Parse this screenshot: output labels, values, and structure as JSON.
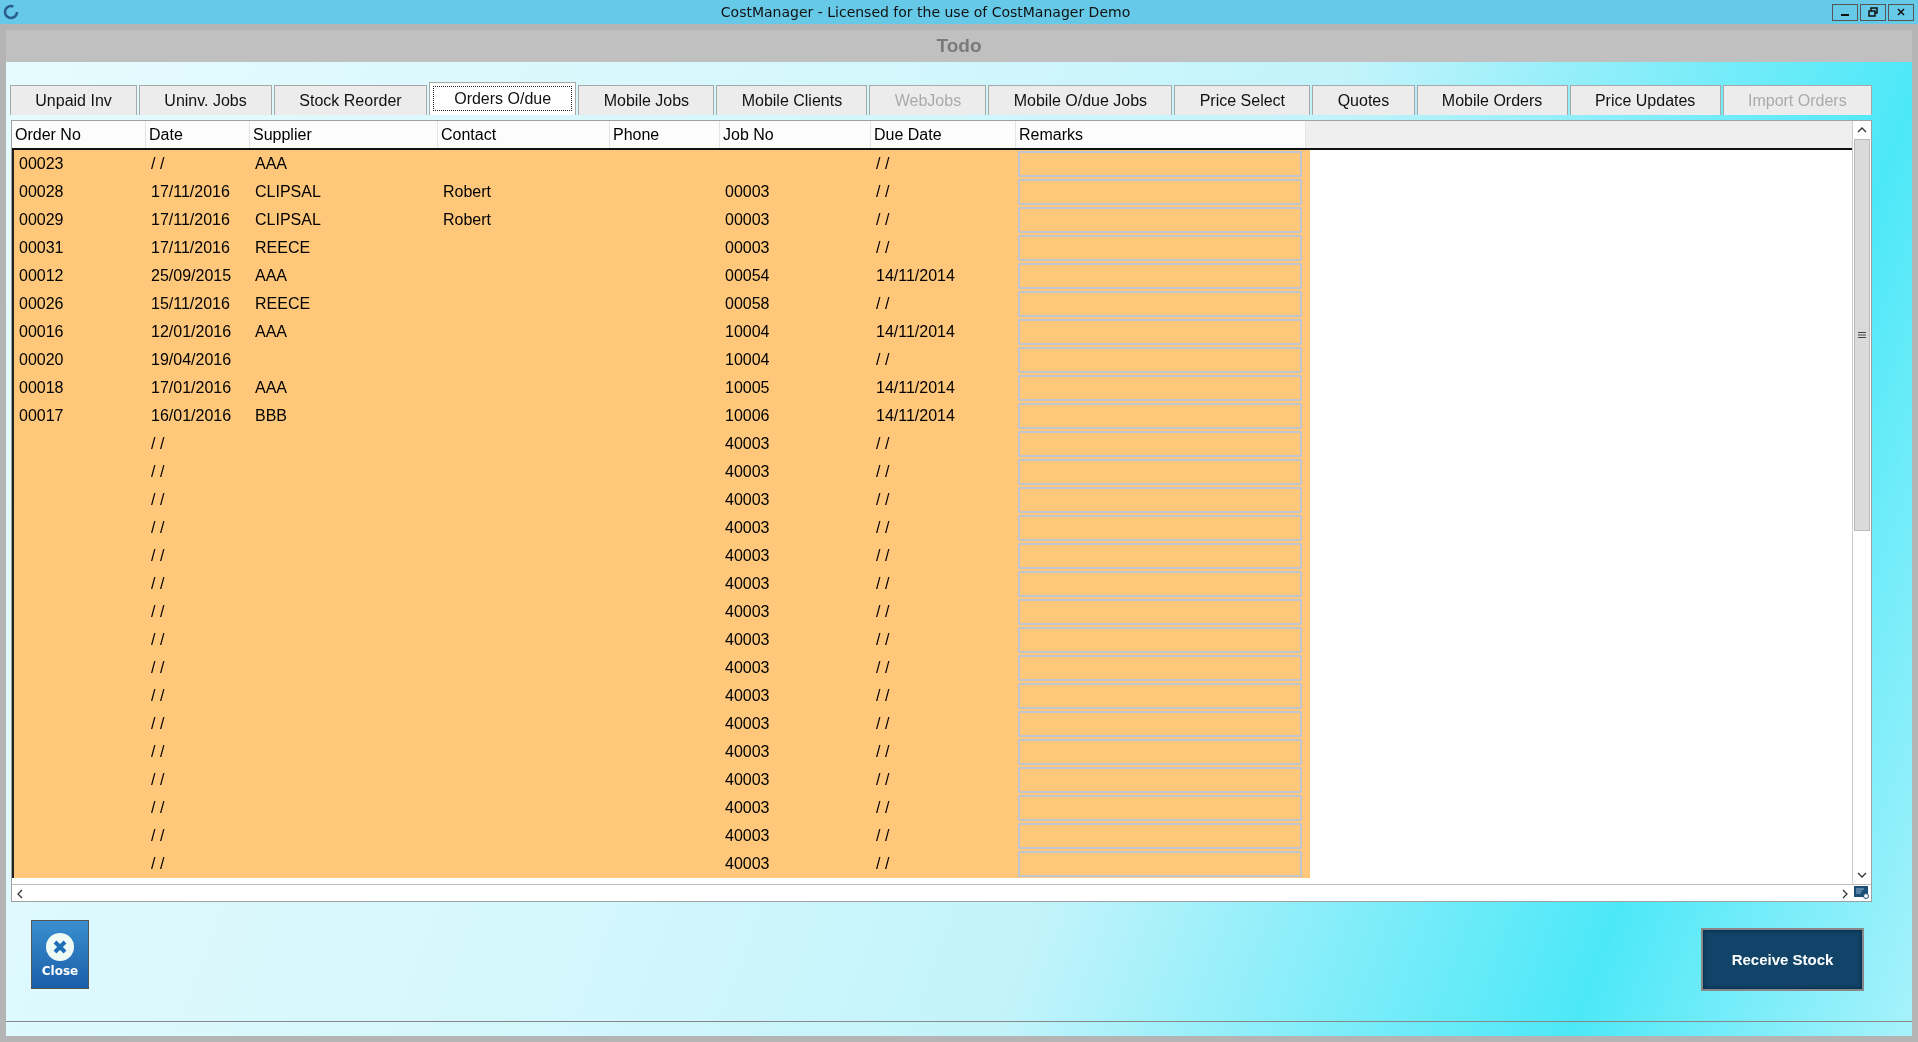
{
  "window": {
    "title": "CostManager - Licensed for the use of CostManager Demo"
  },
  "form_title": "Todo",
  "tabs": [
    {
      "label": "Unpaid Inv",
      "selected": false,
      "disabled": false
    },
    {
      "label": "Uninv. Jobs",
      "selected": false,
      "disabled": false
    },
    {
      "label": "Stock Reorder",
      "selected": false,
      "disabled": false
    },
    {
      "label": "Orders O/due",
      "selected": true,
      "disabled": false
    },
    {
      "label": "Mobile Jobs",
      "selected": false,
      "disabled": false
    },
    {
      "label": "Mobile Clients",
      "selected": false,
      "disabled": false
    },
    {
      "label": "WebJobs",
      "selected": false,
      "disabled": true
    },
    {
      "label": "Mobile O/due Jobs",
      "selected": false,
      "disabled": false
    },
    {
      "label": "Price Select",
      "selected": false,
      "disabled": false
    },
    {
      "label": "Quotes",
      "selected": false,
      "disabled": false
    },
    {
      "label": "Mobile Orders",
      "selected": false,
      "disabled": false
    },
    {
      "label": "Price Updates",
      "selected": false,
      "disabled": false
    },
    {
      "label": "Import Orders",
      "selected": false,
      "disabled": true
    }
  ],
  "table": {
    "columns": [
      "Order No",
      "Date",
      "Supplier",
      "Contact",
      "Phone",
      "Job No",
      "Due Date",
      "Remarks"
    ],
    "rows": [
      {
        "order_no": "00023",
        "date": "/ /",
        "supplier": "AAA",
        "due_date": "/ /"
      },
      {
        "order_no": "00028",
        "date": "17/11/2016",
        "supplier": "CLIPSAL",
        "contact": "Robert",
        "job_no": "00003",
        "due_date": "/ /"
      },
      {
        "order_no": "00029",
        "date": "17/11/2016",
        "supplier": "CLIPSAL",
        "contact": "Robert",
        "job_no": "00003",
        "due_date": "/ /"
      },
      {
        "order_no": "00031",
        "date": "17/11/2016",
        "supplier": "REECE",
        "job_no": "00003",
        "due_date": "/ /"
      },
      {
        "order_no": "00012",
        "date": "25/09/2015",
        "supplier": "AAA",
        "job_no": "00054",
        "due_date": "14/11/2014"
      },
      {
        "order_no": "00026",
        "date": "15/11/2016",
        "supplier": "REECE",
        "job_no": "00058",
        "due_date": "/ /"
      },
      {
        "order_no": "00016",
        "date": "12/01/2016",
        "supplier": "AAA",
        "job_no": "10004",
        "due_date": "14/11/2014"
      },
      {
        "order_no": "00020",
        "date": "19/04/2016",
        "job_no": "10004",
        "due_date": "/ /"
      },
      {
        "order_no": "00018",
        "date": "17/01/2016",
        "supplier": "AAA",
        "job_no": "10005",
        "due_date": "14/11/2014"
      },
      {
        "order_no": "00017",
        "date": "16/01/2016",
        "supplier": "BBB",
        "job_no": "10006",
        "due_date": "14/11/2014"
      },
      {
        "date": "/ /",
        "job_no": "40003",
        "due_date": "/ /"
      },
      {
        "date": "/ /",
        "job_no": "40003",
        "due_date": "/ /"
      },
      {
        "date": "/ /",
        "job_no": "40003",
        "due_date": "/ /"
      },
      {
        "date": "/ /",
        "job_no": "40003",
        "due_date": "/ /"
      },
      {
        "date": "/ /",
        "job_no": "40003",
        "due_date": "/ /"
      },
      {
        "date": "/ /",
        "job_no": "40003",
        "due_date": "/ /"
      },
      {
        "date": "/ /",
        "job_no": "40003",
        "due_date": "/ /"
      },
      {
        "date": "/ /",
        "job_no": "40003",
        "due_date": "/ /"
      },
      {
        "date": "/ /",
        "job_no": "40003",
        "due_date": "/ /"
      },
      {
        "date": "/ /",
        "job_no": "40003",
        "due_date": "/ /"
      },
      {
        "date": "/ /",
        "job_no": "40003",
        "due_date": "/ /"
      },
      {
        "date": "/ /",
        "job_no": "40003",
        "due_date": "/ /"
      },
      {
        "date": "/ /",
        "job_no": "40003",
        "due_date": "/ /"
      },
      {
        "date": "/ /",
        "job_no": "40003",
        "due_date": "/ /"
      },
      {
        "date": "/ /",
        "job_no": "40003",
        "due_date": "/ /"
      },
      {
        "date": "/ /",
        "job_no": "40003",
        "due_date": "/ /"
      }
    ]
  },
  "buttons": {
    "close": "Close",
    "receive": "Receive Stock"
  }
}
